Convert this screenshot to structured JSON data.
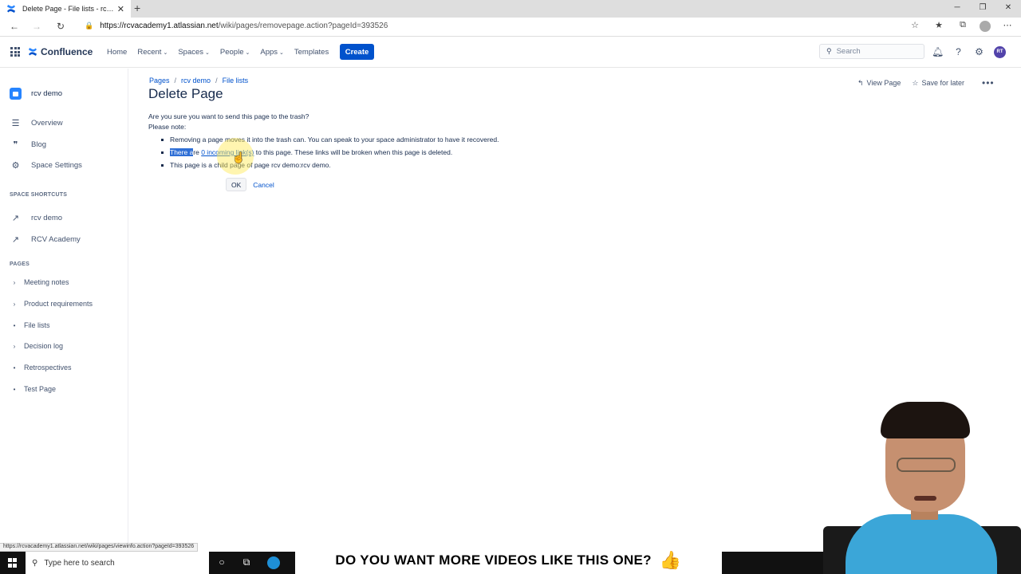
{
  "browser": {
    "tab_title": "Delete Page - File lists - rcv dem",
    "url_host": "https://rcvacademy1.atlassian.net",
    "url_path": "/wiki/pages/removepage.action?pageId=393526",
    "status_url": "https://rcvacademy1.atlassian.net/wiki/pages/viewinfo.action?pageId=393526",
    "window_controls": [
      "─",
      "❐",
      "✕"
    ]
  },
  "header": {
    "product_name": "Confluence",
    "nav": [
      {
        "label": "Home",
        "has_caret": false
      },
      {
        "label": "Recent",
        "has_caret": true
      },
      {
        "label": "Spaces",
        "has_caret": true
      },
      {
        "label": "People",
        "has_caret": true
      },
      {
        "label": "Apps",
        "has_caret": true
      },
      {
        "label": "Templates",
        "has_caret": false
      }
    ],
    "create_label": "Create",
    "search_placeholder": "Search",
    "user_initials": "RT"
  },
  "sidebar": {
    "space_name": "rcv demo",
    "links": [
      {
        "label": "Overview",
        "icon": "menu-lines-icon"
      },
      {
        "label": "Blog",
        "icon": "quote-icon"
      },
      {
        "label": "Space Settings",
        "icon": "gear-icon"
      }
    ],
    "shortcuts_heading": "SPACE SHORTCUTS",
    "shortcuts": [
      "rcv demo",
      "RCV Academy"
    ],
    "pages_heading": "PAGES",
    "pages": [
      {
        "label": "Meeting notes",
        "expandable": true
      },
      {
        "label": "Product requirements",
        "expandable": true
      },
      {
        "label": "File lists",
        "expandable": false
      },
      {
        "label": "Decision log",
        "expandable": true
      },
      {
        "label": "Retrospectives",
        "expandable": false
      },
      {
        "label": "Test Page",
        "expandable": false
      }
    ]
  },
  "page": {
    "breadcrumb": [
      "Pages",
      "rcv demo",
      "File lists"
    ],
    "title": "Delete Page",
    "view_page": "View Page",
    "save_for_later": "Save for later",
    "question": "Are you sure you want to send this page to the trash?",
    "note_label": "Please note:",
    "bullet1": "Removing a page moves it into the trash can. You can speak to your space administrator to have it recovered.",
    "bullet2_selected": "There a",
    "bullet2_pre": "re ",
    "bullet2_link": "0 incoming link(s)",
    "bullet2_post": " to this page. These links will be broken when this page is deleted.",
    "bullet3": "This page is a child page of page rcv demo:rcv demo.",
    "ok_label": "OK",
    "cancel_label": "Cancel"
  },
  "taskbar": {
    "search_placeholder": "Type here to search"
  },
  "banner": {
    "text": "DO YOU WANT MORE VIDEOS LIKE THIS ONE?"
  }
}
